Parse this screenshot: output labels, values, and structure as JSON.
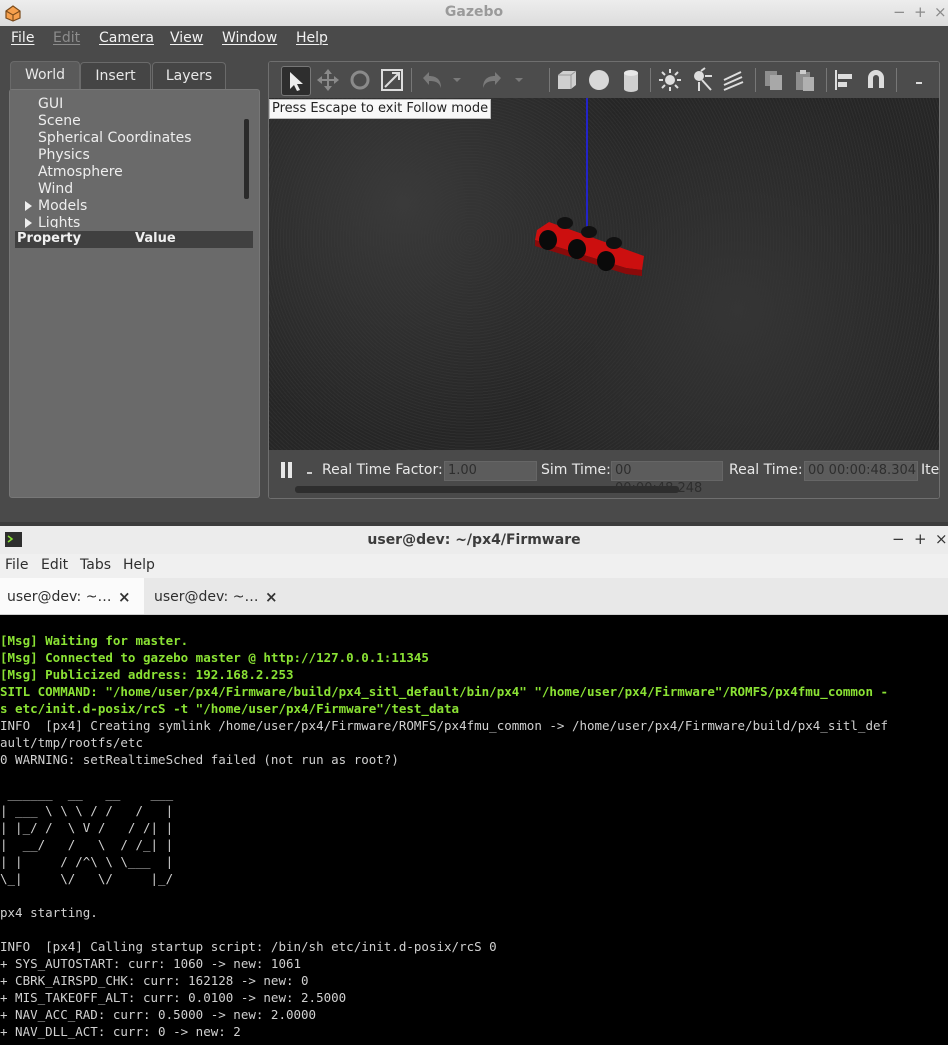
{
  "gazebo": {
    "title": "Gazebo",
    "controls": [
      "−",
      "+",
      "×"
    ],
    "menu": [
      "File",
      "Edit",
      "Camera",
      "View",
      "Window",
      "Help"
    ],
    "tabs": [
      "World",
      "Insert",
      "Layers"
    ],
    "tree": [
      "GUI",
      "Scene",
      "Spherical Coordinates",
      "Physics",
      "Atmosphere",
      "Wind",
      "Models",
      "Lights"
    ],
    "property_header": {
      "property": "Property",
      "value": "Value"
    },
    "hint": "Press Escape to exit Follow mode",
    "status": {
      "rtf_label": "Real Time Factor:",
      "rtf_value": "1.00",
      "sim_label": "Sim Time:",
      "sim_value": "00 00:00:48.248",
      "real_label": "Real Time:",
      "real_value": "00 00:00:48.304",
      "iter_label": "Ite"
    }
  },
  "terminal": {
    "title": "user@dev: ~/px4/Firmware",
    "controls": [
      "−",
      "+",
      "×"
    ],
    "menu": [
      "File",
      "Edit",
      "Tabs",
      "Help"
    ],
    "tabs": [
      {
        "label": "user@dev: ~…",
        "close": "×"
      },
      {
        "label": "user@dev: ~…",
        "close": "×"
      }
    ],
    "lines": [
      "[Msg] Waiting for master.",
      "[Msg] Connected to gazebo master @ http://127.0.0.1:11345",
      "[Msg] Publicized address: 192.168.2.253",
      "SITL COMMAND: \"/home/user/px4/Firmware/build/px4_sitl_default/bin/px4\" \"/home/user/px4/Firmware\"/ROMFS/px4fmu_common -",
      "s etc/init.d-posix/rcS -t \"/home/user/px4/Firmware\"/test_data",
      "INFO  [px4] Creating symlink /home/user/px4/Firmware/ROMFS/px4fmu_common -> /home/user/px4/Firmware/build/px4_sitl_def",
      "ault/tmp/rootfs/etc",
      "0 WARNING: setRealtimeSched failed (not run as root?)",
      "",
      " ______  __   __    ___ ",
      "| ___ \\ \\ \\ / /   /   |",
      "| |_/ /  \\ V /   / /| |",
      "|  __/   /   \\  / /_| |",
      "| |     / /^\\ \\ \\___  |",
      "\\_|     \\/   \\/     |_/",
      "",
      "px4 starting.",
      "",
      "INFO  [px4] Calling startup script: /bin/sh etc/init.d-posix/rcS 0",
      "+ SYS_AUTOSTART: curr: 1060 -> new: 1061",
      "+ CBRK_AIRSPD_CHK: curr: 162128 -> new: 0",
      "+ MIS_TAKEOFF_ALT: curr: 0.0100 -> new: 2.5000",
      "+ NAV_ACC_RAD: curr: 0.5000 -> new: 2.0000",
      "+ NAV_DLL_ACT: curr: 0 -> new: 2"
    ],
    "green_lines": 5
  }
}
